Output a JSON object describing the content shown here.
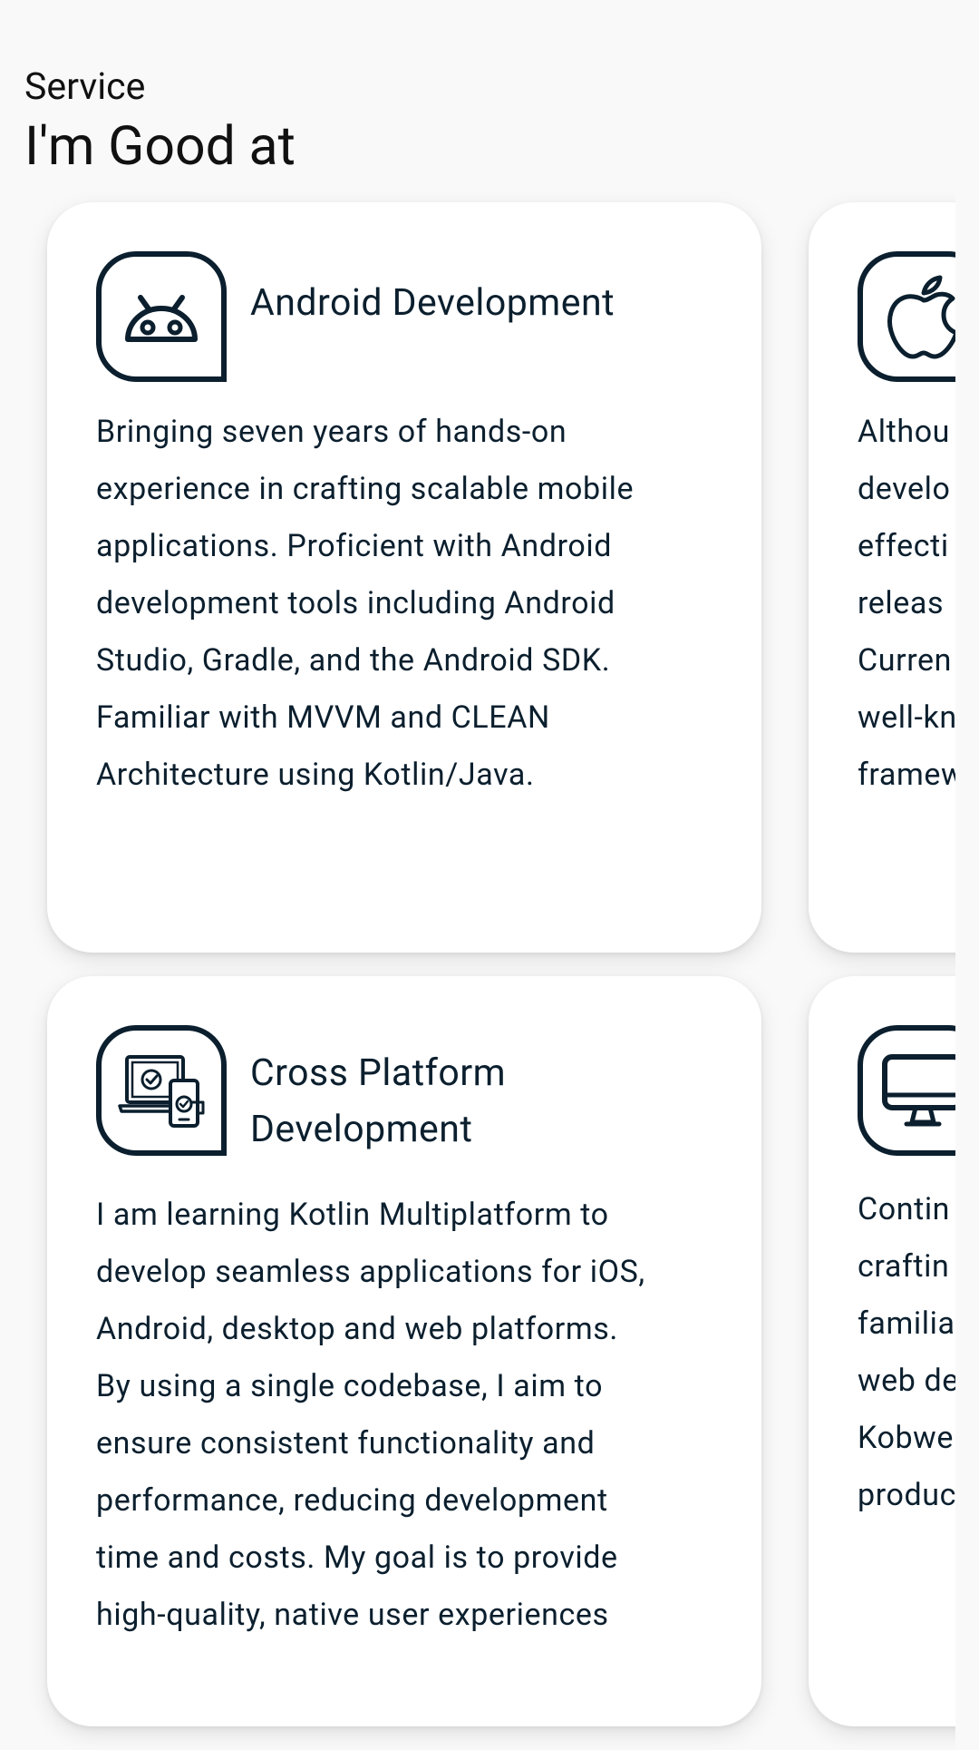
{
  "header": {
    "eyebrow": "Service",
    "title": "I'm Good at"
  },
  "cards": [
    {
      "title": "Android Development",
      "icon": "android-icon",
      "body": "Bringing seven years of hands-on\nexperience in crafting scalable mobile\napplications. Proficient with Android\ndevelopment tools including Android\nStudio, Gradle, and the Android SDK.\nFamiliar with MVVM and CLEAN\nArchitecture using Kotlin/Java."
    },
    {
      "title": "",
      "icon": "apple-icon",
      "body": "Althou\ndevelo\neffecti\nreleas\nCurren\nwell-kn\nframew"
    },
    {
      "title": "Cross Platform\nDevelopment",
      "icon": "cross-platform-devices-icon",
      "body": "I am learning Kotlin Multiplatform to\ndevelop seamless applications for iOS,\nAndroid, desktop and web platforms.\nBy using a single codebase, I aim to\nensure consistent functionality and\nperformance, reducing development\ntime and costs. My goal is to provide\nhigh-quality, native user experiences"
    },
    {
      "title": "",
      "icon": "desktop-monitor-icon",
      "body": "Contin\ncraftin\nfamilia\nweb de\nKobwe\nproduc"
    }
  ],
  "colors": {
    "background": "#f9f9f9",
    "card": "#ffffff",
    "ink": "#0b1f2e"
  }
}
